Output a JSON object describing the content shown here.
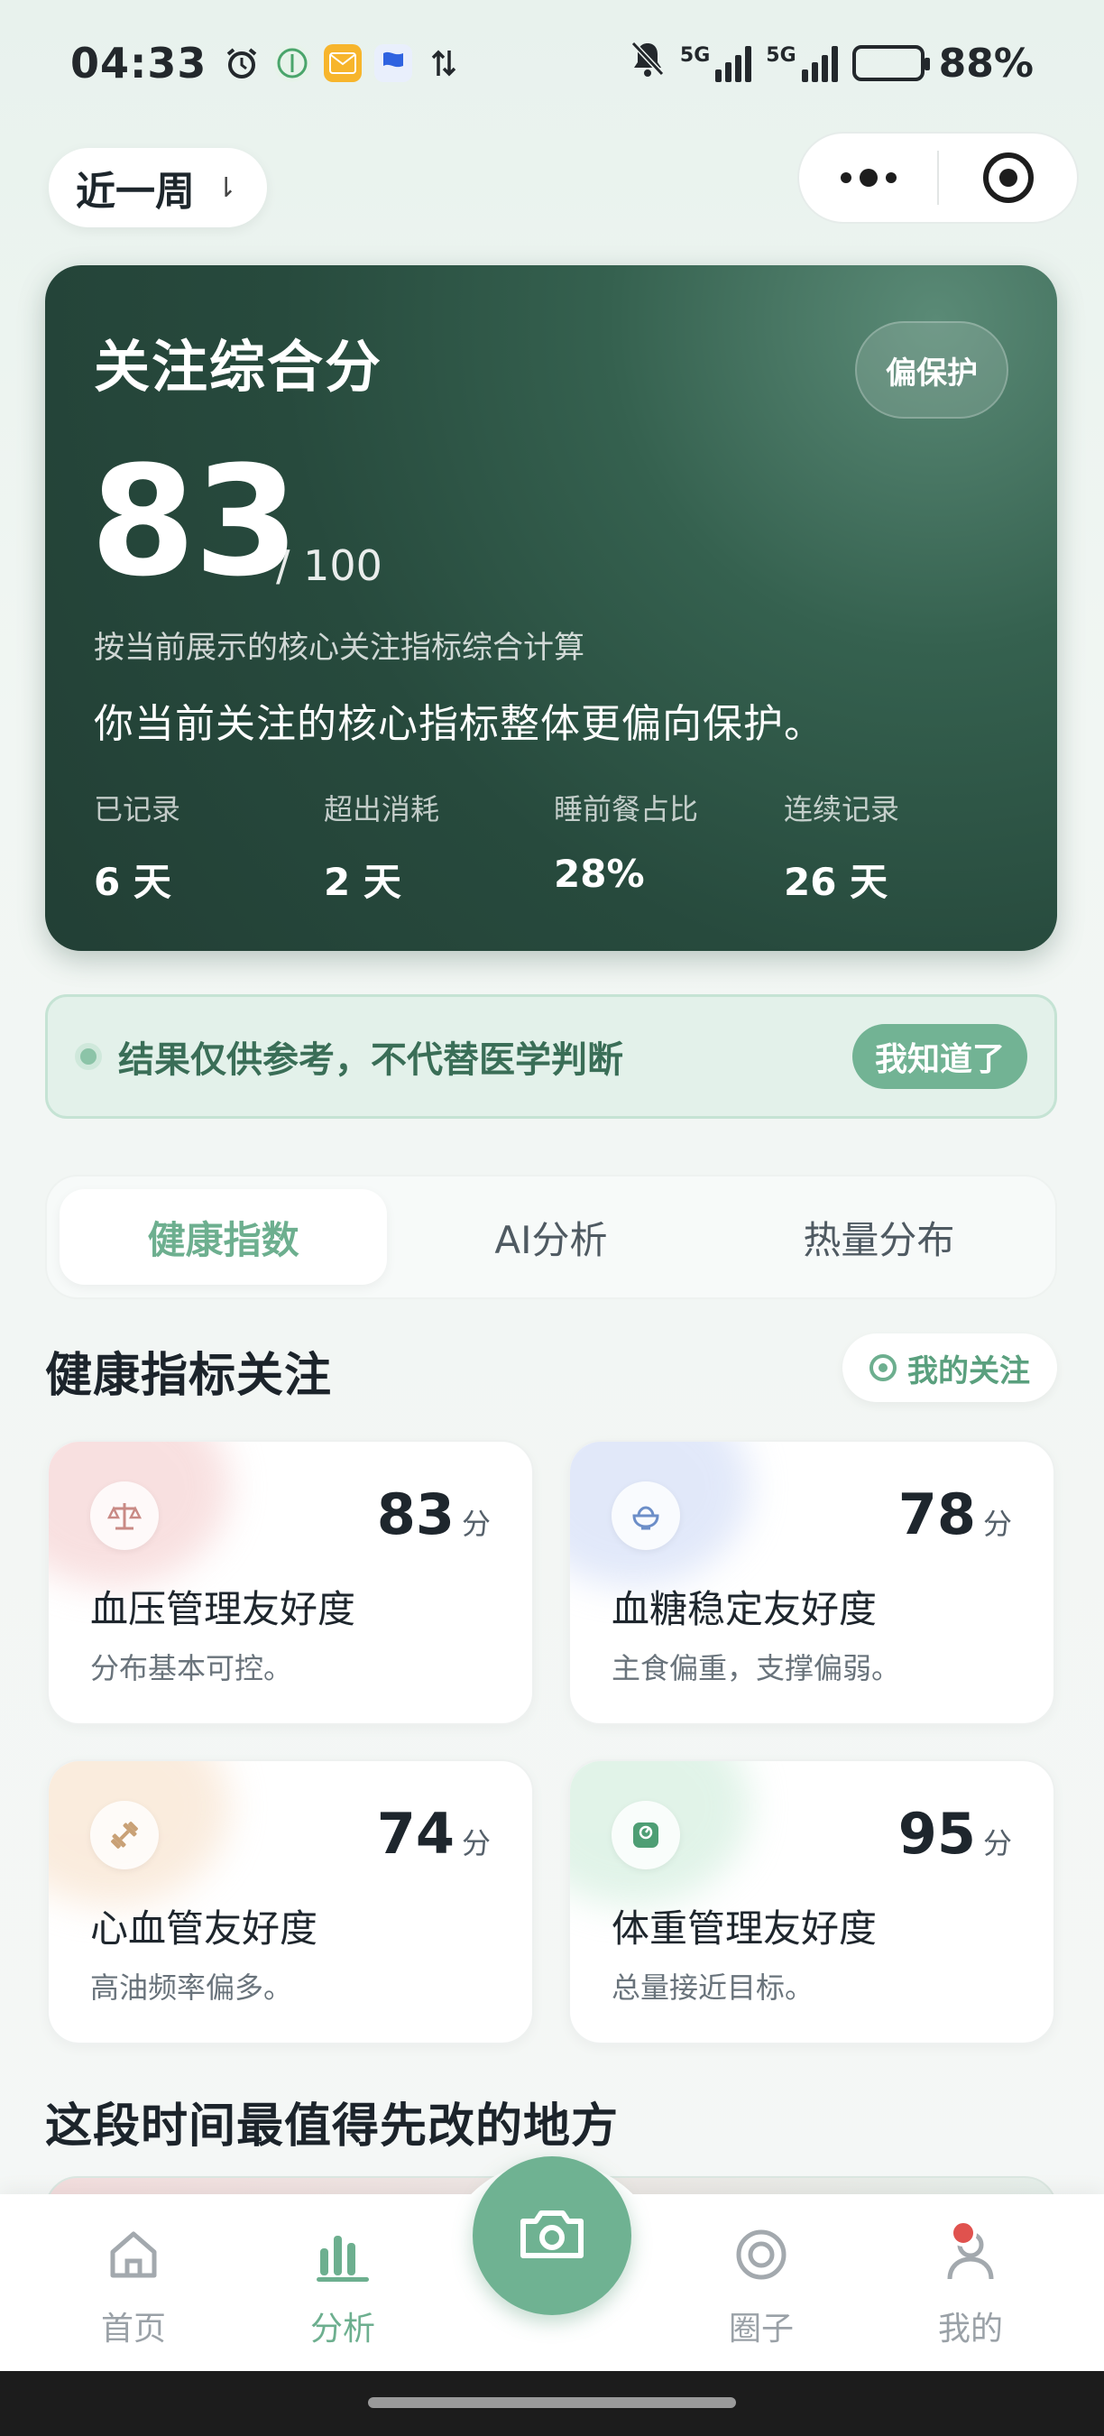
{
  "status": {
    "time": "04:33",
    "network1": "5G",
    "network2": "5G",
    "battery": "88%",
    "battery_level": 0.88
  },
  "top": {
    "period_label": "近一周",
    "period_arrow": "⇂"
  },
  "score_card": {
    "title": "关注综合分",
    "tag": "偏保护",
    "score": "83",
    "max": "/ 100",
    "desc": "按当前展示的核心关注指标综合计算",
    "summary": "你当前关注的核心指标整体更偏向保护。",
    "stats": [
      {
        "label": "已记录",
        "value": "6 天"
      },
      {
        "label": "超出消耗",
        "value": "2 天"
      },
      {
        "label": "睡前餐占比",
        "value": "28%"
      },
      {
        "label": "连续记录",
        "value": "26 天"
      }
    ]
  },
  "notice": {
    "text": "结果仅供参考，不代替医学判断",
    "button": "我知道了"
  },
  "tabs": [
    {
      "label": "健康指数"
    },
    {
      "label": "AI分析"
    },
    {
      "label": "热量分布"
    }
  ],
  "section": {
    "title": "健康指标关注",
    "follow_button": "我的关注"
  },
  "metrics": [
    {
      "icon": "scale-icon",
      "score": "83",
      "unit": "分",
      "name": "血压管理友好度",
      "desc": "分布基本可控。",
      "accent": "#f3c7c7"
    },
    {
      "icon": "bowl-icon",
      "score": "78",
      "unit": "分",
      "name": "血糖稳定友好度",
      "desc": "主食偏重，支撑偏弱。",
      "accent": "#c9d6f5"
    },
    {
      "icon": "dumbbell-icon",
      "score": "74",
      "unit": "分",
      "name": "心血管友好度",
      "desc": "高油频率偏多。",
      "accent": "#f6dcc2"
    },
    {
      "icon": "weight-scale-icon",
      "score": "95",
      "unit": "分",
      "name": "体重管理友好度",
      "desc": "总量接近目标。",
      "accent": "#c8ead6"
    }
  ],
  "section2": {
    "title": "这段时间最值得先改的地方"
  },
  "nav": [
    {
      "label": "首页",
      "icon": "home-icon"
    },
    {
      "label": "分析",
      "icon": "bar-chart-icon"
    },
    {
      "label": "圈子",
      "icon": "circle-icon"
    },
    {
      "label": "我的",
      "icon": "profile-icon"
    }
  ],
  "colors": {
    "accent": "#6daf8f",
    "card_dark": "#274a3d",
    "badge": "#e0524e"
  }
}
